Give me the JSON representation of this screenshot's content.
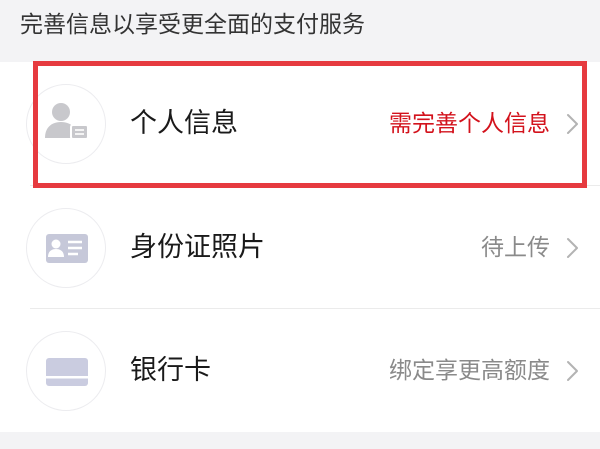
{
  "header": {
    "text": "完善信息以享受更全面的支付服务"
  },
  "items": [
    {
      "label": "个人信息",
      "status": "需完善个人信息",
      "status_color": "#d3121c",
      "icon": "person-card-icon"
    },
    {
      "label": "身份证照片",
      "status": "待上传",
      "status_color": "#8a8a8a",
      "icon": "id-card-icon"
    },
    {
      "label": "银行卡",
      "status": "绑定享更高额度",
      "status_color": "#8a8a8a",
      "icon": "bank-card-icon"
    }
  ],
  "colors": {
    "background": "#f3f3f5",
    "highlight_border": "#e63a3f",
    "chevron": "#b3b3b3"
  }
}
